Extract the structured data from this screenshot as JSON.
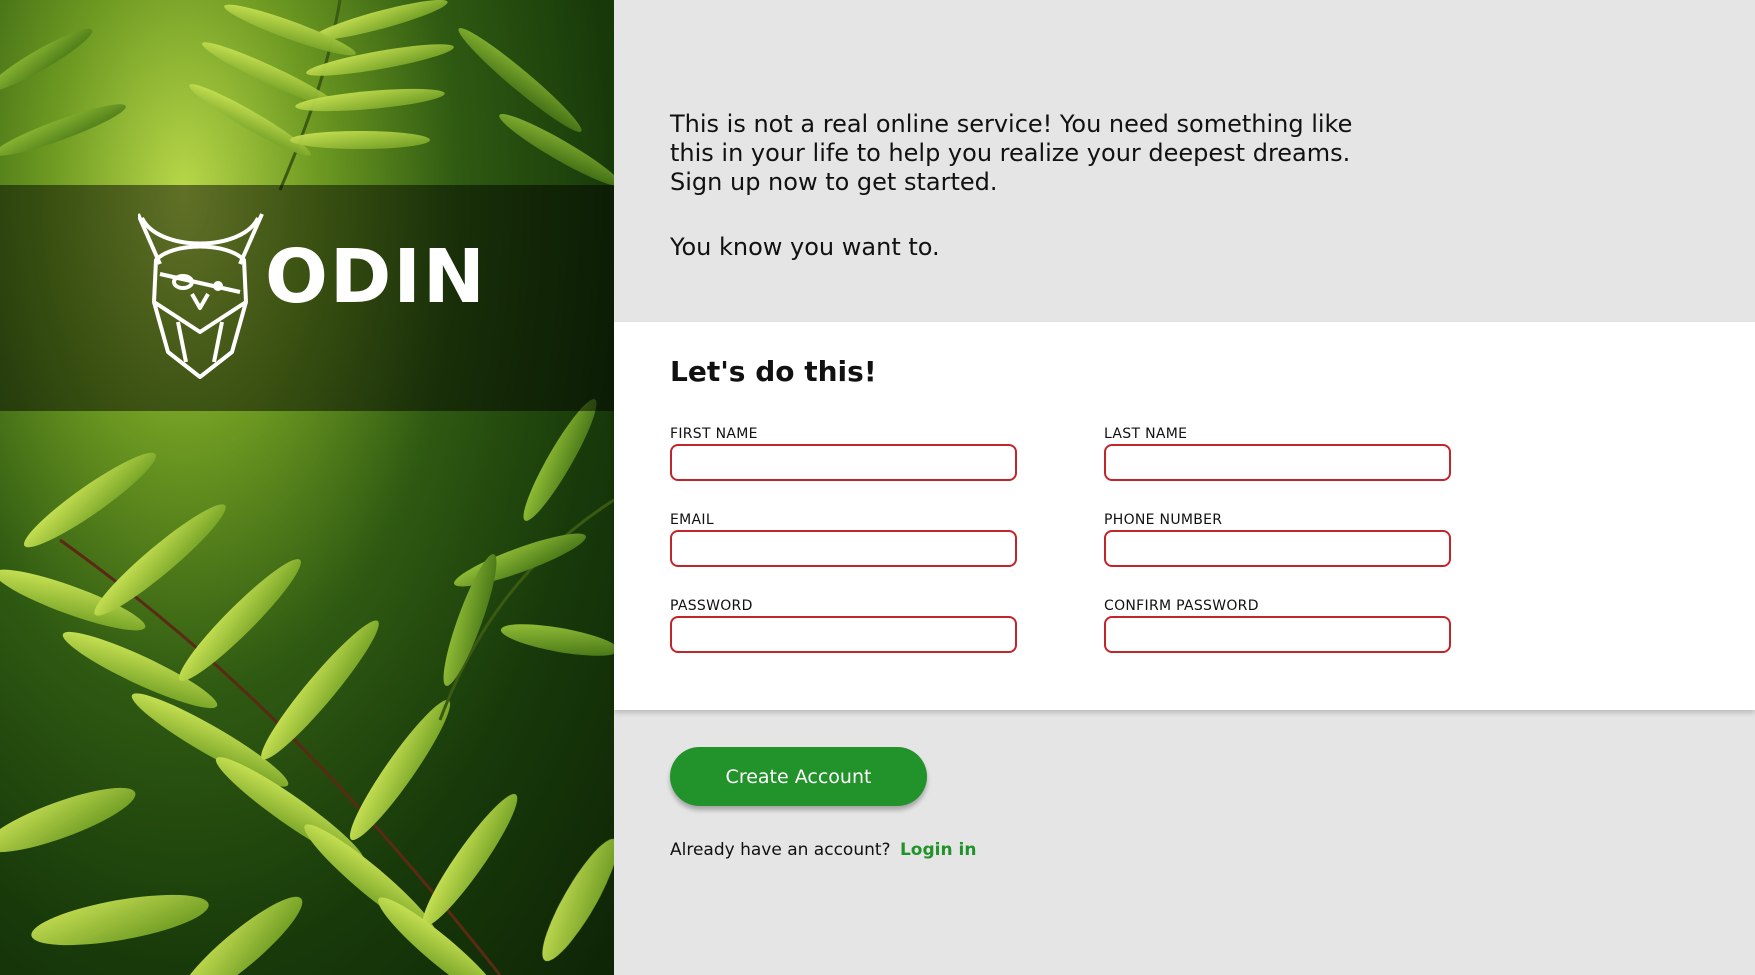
{
  "brand": {
    "name": "ODIN"
  },
  "intro": {
    "paragraph1": "This is not a real online service! You need something like this in your life to help you realize your deepest dreams. Sign up now to get started.",
    "paragraph2": "You know you want to."
  },
  "form": {
    "title": "Let's do this!",
    "fields": {
      "first_name": {
        "label": "FIRST NAME",
        "value": ""
      },
      "last_name": {
        "label": "LAST NAME",
        "value": ""
      },
      "email": {
        "label": "EMAIL",
        "value": ""
      },
      "phone": {
        "label": "PHONE NUMBER",
        "value": ""
      },
      "password": {
        "label": "PASSWORD",
        "value": ""
      },
      "confirm_password": {
        "label": "CONFIRM PASSWORD",
        "value": ""
      }
    }
  },
  "actions": {
    "create_label": "Create Account",
    "login_prompt": "Already have an account?",
    "login_link": "Login in"
  },
  "colors": {
    "accent_green": "#22922a",
    "input_border": "#c0252a",
    "panel_gray": "#e5e5e5"
  },
  "icons": {
    "logo": "odin-viking-head-icon",
    "background": "fern-foliage-image"
  }
}
